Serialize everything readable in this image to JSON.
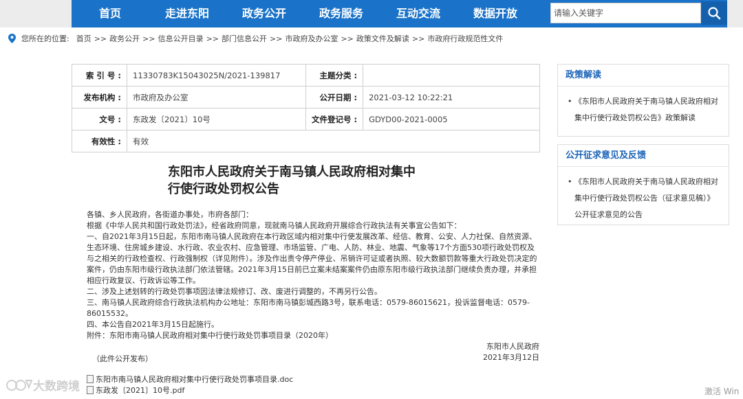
{
  "nav": {
    "items": [
      "首页",
      "走进东阳",
      "政务公开",
      "政务服务",
      "互动交流",
      "数据开放"
    ],
    "search_placeholder": "请输入关键字"
  },
  "breadcrumb": {
    "label": "您所在的位置:",
    "items": [
      "首页",
      "政务公开",
      "信息公开目录",
      "部门信息公开",
      "市政府及办公室",
      "政策文件及解读",
      "市政府行政规范性文件"
    ],
    "sep": ">>"
  },
  "meta": {
    "index_key": "索 引 号 :",
    "index_val": "11330783K15043025N/2021-139817",
    "topic_key": "主题分类 :",
    "topic_val": "",
    "issuer_key": "发布机构 :",
    "issuer_val": "市政府及办公室",
    "date_key": "公开日期 :",
    "date_val": "2021-03-12 10:22:21",
    "docno_key": "文号 :",
    "docno_val": "东政发〔2021〕10号",
    "reg_key": "文件登记号 :",
    "reg_val": "GDYD00-2021-0005",
    "valid_key": "有效性 :",
    "valid_val": "有效"
  },
  "doc": {
    "title_line1": "东阳市人民政府关于南马镇人民政府相对集中",
    "title_line2": "行使行政处罚权公告",
    "salutation": "各镇、乡人民政府，各街道办事处，市府各部门：",
    "intro": "根据《中华人民共和国行政处罚法》，经省政府同意，现就南马镇人民政府开展综合行政执法有关事宜公告如下：",
    "p1": "一、自2021年3月15日起，东阳市南马镇人民政府在本行政区域内相对集中行使发展改革、经信、教育、公安、人力社保、自然资源、生态环境、住房城乡建设、水行政、农业农村、应急管理、市场监管、广电、人防、林业、地震、气象等17个方面530项行政处罚权及与之相关的行政检查权、行政强制权（详见附件）。涉及作出责令停产停业、吊销许可证或者执照、较大数额罚款等重大行政处罚决定的案件，仍由东阳市级行政执法部门依法管辖。2021年3月15日前已立案未结案案件仍由原东阳市级行政执法部门继续负责办理，并承担相应行政复议、行政诉讼等工作。",
    "p2": "二、涉及上述划转的行政处罚事项因法律法规修订、改、废进行调整的，不再另行公告。",
    "p3": "三、南马镇人民政府综合行政执法机构办公地址：东阳市南马镇彭城西路3号，联系电话：0579-86015621，投诉监督电话：0579-86015532。",
    "p4": "四、本公告自2021年3月15日起施行。",
    "attach_note": "附件：东阳市南马镇人民政府相对集中行使行政处罚事项目录（2020年）",
    "sign_org": "东阳市人民政府",
    "sign_date": "2021年3月12日",
    "public_note": "（此件公开发布）",
    "attachments": [
      "东阳市南马镇人民政府相对集中行使行政处罚事项目录.doc",
      "东政发〔2021〕10号.pdf"
    ]
  },
  "sidebar": {
    "policy_title": "政策解读",
    "policy_items": [
      "《东阳市人民政府关于南马镇人民政府相对集中行使行政处罚权公告》政策解读"
    ],
    "consult_title": "公开征求意见及反馈",
    "consult_items": [
      "《东阳市人民政府关于南马镇人民政府相对集中行使行政处罚权公告（征求意见稿）》公开征求意见的公告"
    ]
  },
  "watermark": {
    "brand": "大数跨境",
    "activate": "激活 Win"
  },
  "colors": {
    "nav_bg": "#1a73c9",
    "search_btn": "#1560ad",
    "side_head": "#1a63b8"
  }
}
